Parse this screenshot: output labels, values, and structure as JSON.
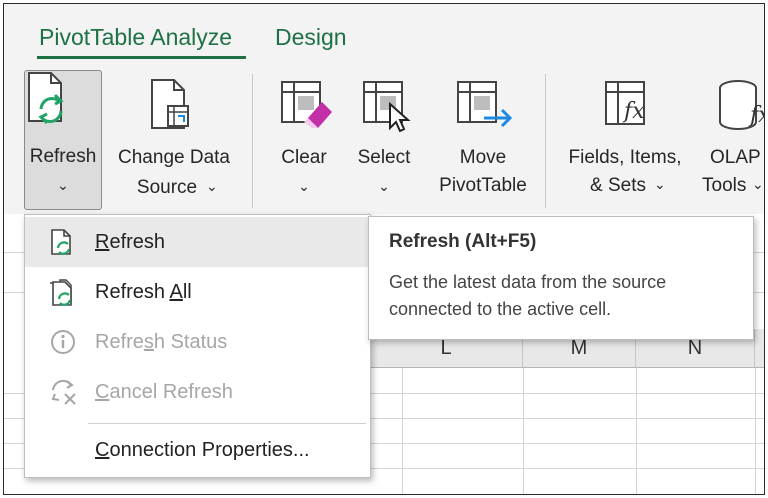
{
  "tabs": [
    {
      "label": "PivotTable Analyze",
      "active": true
    },
    {
      "label": "Design",
      "active": false
    }
  ],
  "ribbon": {
    "refresh": {
      "label": "Refresh",
      "icon": "refresh-doc-icon"
    },
    "change_data_source": {
      "line1": "Change Data",
      "line2": "Source",
      "icon": "change-source-icon"
    },
    "clear": {
      "label": "Clear",
      "icon": "clear-eraser-icon"
    },
    "select": {
      "label": "Select",
      "icon": "select-cursor-icon"
    },
    "move_pivottable": {
      "line1": "Move",
      "line2": "PivotTable",
      "icon": "move-arrow-icon"
    },
    "fields_items_sets": {
      "line1": "Fields, Items,",
      "line2": "& Sets",
      "icon": "fx-icon"
    },
    "olap_tools": {
      "line1": "OLAP",
      "line2": "Tools",
      "icon": "olap-cylinder-icon"
    }
  },
  "sheet": {
    "columns": [
      "L",
      "M",
      "N"
    ]
  },
  "menu": {
    "items": [
      {
        "pre": "",
        "ul": "R",
        "post": "efresh",
        "disabled": false,
        "hover": true,
        "icon": "refresh-doc-icon"
      },
      {
        "pre": "Refresh ",
        "ul": "A",
        "post": "ll",
        "disabled": false,
        "hover": false,
        "icon": "refresh-all-icon"
      },
      {
        "pre": "Refre",
        "ul": "s",
        "post": "h Status",
        "disabled": true,
        "hover": false,
        "icon": "info-circle-icon"
      },
      {
        "pre": "",
        "ul": "C",
        "post": "ancel Refresh",
        "disabled": true,
        "hover": false,
        "icon": "cancel-refresh-icon"
      },
      {
        "pre": "",
        "ul": "C",
        "post": "onnection Properties...",
        "disabled": false,
        "hover": false,
        "icon": ""
      }
    ]
  },
  "tooltip": {
    "title": "Refresh (Alt+F5)",
    "description": "Get the latest data from the source connected to the active cell."
  },
  "colors": {
    "accent": "#1e7145",
    "refresh_green": "#21a366",
    "move_blue": "#1e88e5",
    "eraser_pink": "#c22fa6"
  }
}
